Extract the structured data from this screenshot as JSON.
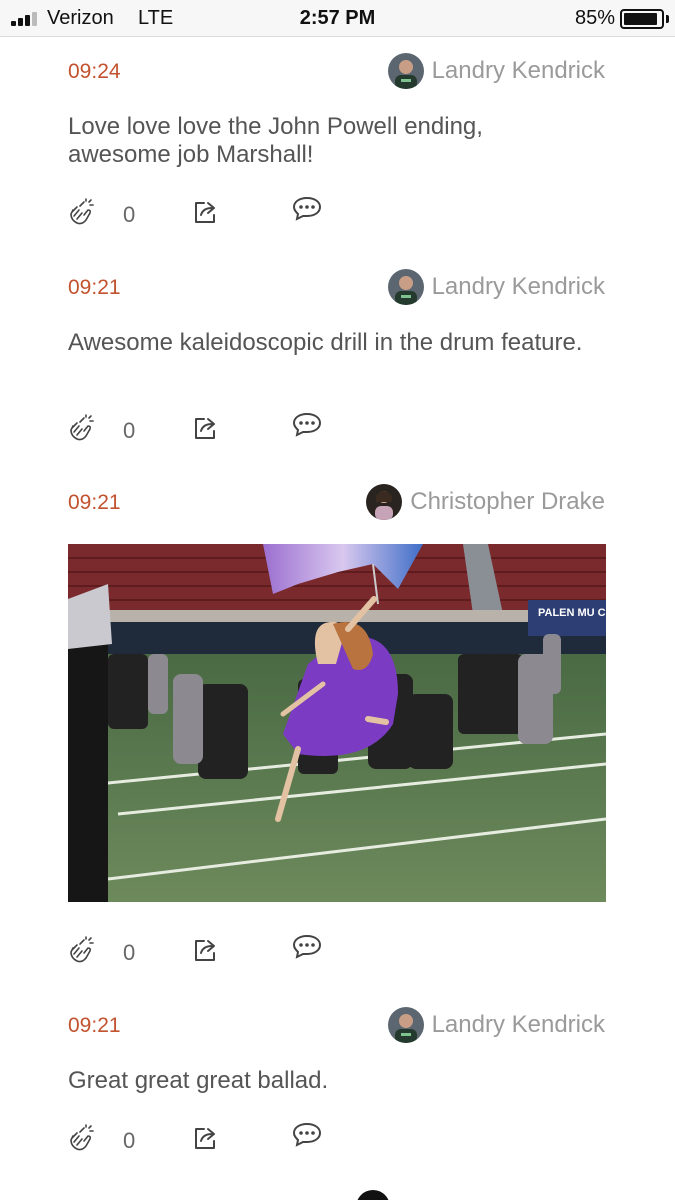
{
  "status_bar": {
    "carrier": "Verizon",
    "network": "LTE",
    "time": "2:57 PM",
    "battery": "85%"
  },
  "posts": [
    {
      "time": "09:24",
      "author": "Landry Kendrick",
      "text": "Love love love the John Powell ending, awesome job Marshall!",
      "claps": "0"
    },
    {
      "time": "09:21",
      "author": "Landry Kendrick",
      "text": "Awesome kaleidoscopic drill in the drum feature.",
      "claps": "0"
    },
    {
      "time": "09:21",
      "author": "Christopher Drake",
      "photo_sign": "PALEN MU CENTER",
      "claps": "0"
    },
    {
      "time": "09:21",
      "author": "Landry Kendrick",
      "text": "Great great great ballad.",
      "claps": "0"
    }
  ],
  "icons": {
    "clap": "clap-icon",
    "share": "share-icon",
    "comment": "comment-icon"
  },
  "colors": {
    "timestamp": "#c2532f",
    "author": "#9a9a9a",
    "text": "#555555",
    "icon": "#444444"
  }
}
